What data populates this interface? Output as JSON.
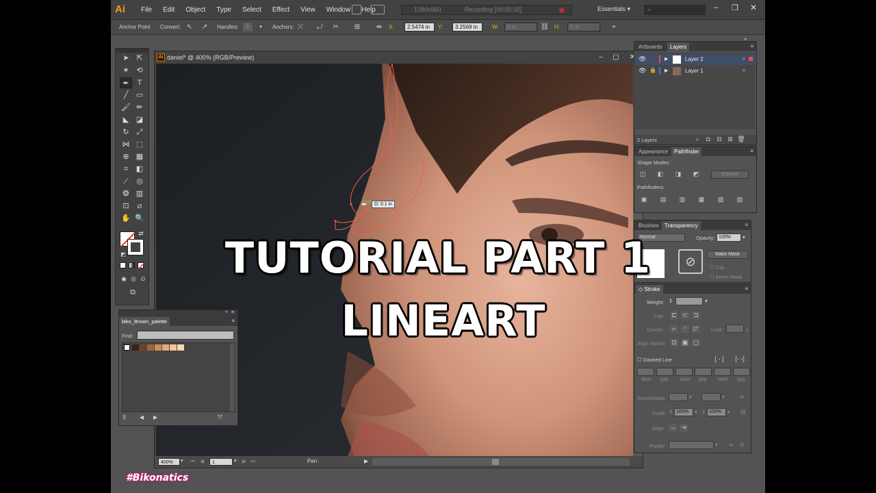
{
  "app": {
    "logo": "Ai",
    "menu": [
      "File",
      "Edit",
      "Object",
      "Type",
      "Select",
      "Effect",
      "View",
      "Window",
      "Help"
    ],
    "capture_size": "1280x960",
    "recording": "Recording [00:05:32]",
    "workspace": "Essentials"
  },
  "control_bar": {
    "mode_label": "Anchor Point",
    "convert_label": "Convert:",
    "handles_label": "Handles:",
    "anchors_label": "Anchors:",
    "x_label": "X:",
    "x_value": "2.5474 in",
    "y_label": "Y:",
    "y_value": "3.2569 in",
    "w_label": "W:",
    "w_value": "0 in",
    "h_label": "H:",
    "h_value": "0 in"
  },
  "document": {
    "title": "daniel* @ 400% (RGB/Preview)",
    "zoom": "400%",
    "artboard": "1",
    "status_tool": "Pen",
    "pen_tooltip": "D: 0.1 in",
    "snap_label": "path"
  },
  "layers_panel": {
    "tabs": [
      "Artboards",
      "Layers"
    ],
    "layers": [
      {
        "name": "Layer 2",
        "color": "#e94b4b"
      },
      {
        "name": "Layer 1",
        "color": "#4b6fe9"
      }
    ],
    "count": "2 Layers"
  },
  "pathfinder_panel": {
    "tabs": [
      "Appearance",
      "Pathfinder"
    ],
    "shape_modes_label": "Shape Modes:",
    "expand_label": "Expand",
    "pathfinders_label": "Pathfinders:"
  },
  "transparency_panel": {
    "tabs": [
      "Brushes",
      "Transparency"
    ],
    "blend_mode": "Normal",
    "opacity_label": "Opacity:",
    "opacity_value": "100%",
    "make_mask": "Make Mask",
    "clip": "Clip",
    "invert_mask": "Invert Mask"
  },
  "stroke_panel": {
    "title": "Stroke",
    "weight_label": "Weight:",
    "cap_label": "Cap:",
    "corner_label": "Corner:",
    "limit_label": "Limit:",
    "limit_unit": "x",
    "align_label": "Align Stroke:",
    "dashed_label": "Dashed Line",
    "dash_labels": [
      "dash",
      "gap",
      "dash",
      "gap",
      "dash",
      "gap"
    ],
    "arrowheads_label": "Arrowheads:",
    "scale_label": "Scale:",
    "scale_1": "100%",
    "scale_2": "100%",
    "align_arrow_label": "Align:",
    "profile_label": "Profile:"
  },
  "swatch_panel": {
    "title": "biko_Brown_palette",
    "find_label": "Find:",
    "find_value": "",
    "swatches": [
      "#3a2418",
      "#6b4328",
      "#9b6640",
      "#c98e5c",
      "#e1ad78",
      "#f1c690",
      "#f7d8a8"
    ]
  },
  "overlay": {
    "line1": "TUTORIAL PART 1",
    "line2": "LINEART",
    "watermark": "#Bikonatics"
  },
  "colors": {
    "ui_dark": "#424242",
    "ui_panel": "#535353",
    "accent": "#f39a1e",
    "path": "#e8604a"
  }
}
